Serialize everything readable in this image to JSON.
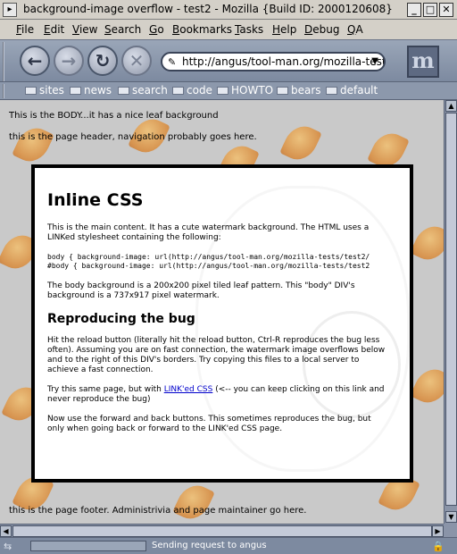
{
  "window": {
    "title": "background-image overflow - test2 - Mozilla {Build ID: 2000120608}",
    "minimize_glyph": "_",
    "maximize_glyph": "□",
    "close_glyph": "✕"
  },
  "menu": [
    "File",
    "Edit",
    "View",
    "Search",
    "Go",
    "Bookmarks",
    "Tasks",
    "Help",
    "Debug",
    "QA"
  ],
  "navigation": {
    "url": "http://angus/tool-man.org/mozilla-tests/",
    "back_glyph": "←",
    "forward_glyph": "→",
    "reload_glyph": "↻",
    "stop_glyph": "✕",
    "logo_text": "m"
  },
  "personal_toolbar": [
    "sites",
    "news",
    "search",
    "code",
    "HOWTO",
    "bears",
    "default"
  ],
  "page": {
    "body_text": "This is the BODY...it has a nice leaf background",
    "header_text": "this is the page header, navigation probably goes here.",
    "footer_text": "this is the page footer. Administrivia and page maintainer go here.",
    "main": {
      "heading": "Inline CSS",
      "intro": "This is the main content. It has a cute watermark background. The HTML uses a LINKed stylesheet containing the following:",
      "code_line1": "body { background-image: url(http://angus/tool-man.org/mozilla-tests/test2/",
      "code_line2": "#body { background-image: url(http://angus/tool-man.org/mozilla-tests/test2",
      "bg_note": "The body background is a 200x200 pixel tiled leaf pattern. This \"body\" DIV's background is a 737x917 pixel watermark.",
      "subheading": "Reproducing the bug",
      "repro": "Hit the reload button (literally hit the reload button, Ctrl-R reproduces the bug less often). Assuming you are on fast connection, the watermark image overflows below and to the right of this DIV's borders. Try copying this files to a local server to achieve a fast connection.",
      "try_prefix": "Try this same page, but with",
      "try_link": "LINK'ed CSS",
      "try_suffix": "(<-- you can keep clicking on this link and never reproduce the bug)",
      "forward_back": "Now use the forward and back buttons. This sometimes reproduces the bug, but only when going back or forward to the LINK'ed CSS page."
    }
  },
  "status": {
    "text": "Sending request to angus",
    "online_glyph": "⇆",
    "security_glyph": "🔒"
  },
  "colors": {
    "chrome": "#d4d0c8",
    "toolbar": "#8c98ac",
    "link": "#0000cc"
  }
}
